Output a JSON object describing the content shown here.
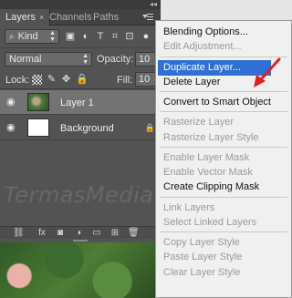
{
  "panel": {
    "tabs": [
      {
        "label": "Layers"
      },
      {
        "label": "Channels"
      },
      {
        "label": "Paths"
      }
    ],
    "tab_close": "×",
    "collapse_glyph": "◂◂",
    "filter": {
      "kind_label": "Kind",
      "kind_icon": "search-icon"
    },
    "blend_mode": "Normal",
    "opacity_label": "Opacity:",
    "opacity_value": "10",
    "lock_label": "Lock:",
    "fill_label": "Fill:",
    "fill_value": "10",
    "layers": [
      {
        "name": "Layer 1",
        "selected": true,
        "thumbnail": "photo"
      },
      {
        "name": "Background",
        "selected": false,
        "thumbnail": "white"
      }
    ],
    "watermark": "TermasMedia"
  },
  "menu": {
    "sections": [
      [
        {
          "label": "Blending Options...",
          "enabled": true
        },
        {
          "label": "Edit Adjustment...",
          "enabled": false
        }
      ],
      [
        {
          "label": "Duplicate Layer...",
          "enabled": true,
          "highlighted": true
        },
        {
          "label": "Delete Layer",
          "enabled": true
        }
      ],
      [
        {
          "label": "Convert to Smart Object",
          "enabled": true
        }
      ],
      [
        {
          "label": "Rasterize Layer",
          "enabled": false
        },
        {
          "label": "Rasterize Layer Style",
          "enabled": false
        }
      ],
      [
        {
          "label": "Enable Layer Mask",
          "enabled": false
        },
        {
          "label": "Enable Vector Mask",
          "enabled": false
        },
        {
          "label": "Create Clipping Mask",
          "enabled": true
        }
      ],
      [
        {
          "label": "Link Layers",
          "enabled": false
        },
        {
          "label": "Select Linked Layers",
          "enabled": false
        }
      ],
      [
        {
          "label": "Copy Layer Style",
          "enabled": false
        },
        {
          "label": "Paste Layer Style",
          "enabled": false
        },
        {
          "label": "Clear Layer Style",
          "enabled": false
        }
      ]
    ]
  },
  "colors": {
    "highlight": "#2f6fd6",
    "annotation_arrow": "#e0201c"
  }
}
